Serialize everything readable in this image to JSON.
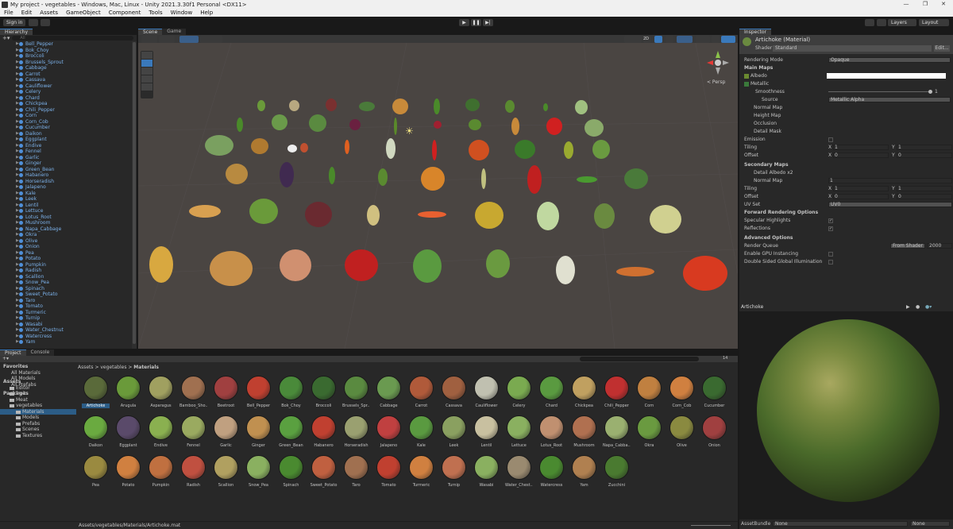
{
  "window": {
    "title": "My project - vegetables - Windows, Mac, Linux - Unity 2021.3.30f1 Personal <DX11>"
  },
  "menu": [
    "File",
    "Edit",
    "Assets",
    "GameObject",
    "Component",
    "Tools",
    "Window",
    "Help"
  ],
  "toolbar": {
    "signin": "Sign in",
    "layers": "Layers",
    "layout": "Layout"
  },
  "hierarchy": {
    "tab": "Hierarchy",
    "search_placeholder": "All",
    "items": [
      "Bell_Pepper",
      "Bok_Choy",
      "Broccoli",
      "Brussels_Sprout",
      "Cabbage",
      "Carrot",
      "Cassava",
      "Cauliflower",
      "Celery",
      "Chard",
      "Chickpea",
      "Chili_Pepper",
      "Corn",
      "Corn_Cob",
      "Cucumber",
      "Daikon",
      "Eggplant",
      "Endive",
      "Fennel",
      "Garlic",
      "Ginger",
      "Green_Bean",
      "Habanero",
      "Horseradish",
      "Jalapeno",
      "Kale",
      "Leek",
      "Lentil",
      "Lettuce",
      "Lotus_Root",
      "Mushroom",
      "Napa_Cabbage",
      "Okra",
      "Olive",
      "Onion",
      "Pea",
      "Potato",
      "Pumpkin",
      "Radish",
      "Scallion",
      "Snow_Pea",
      "Spinach",
      "Sweet_Potato",
      "Taro",
      "Tomato",
      "Turmeric",
      "Turnip",
      "Wasabi",
      "Water_Chestnut",
      "Watercress",
      "Yam"
    ]
  },
  "scene": {
    "tab_scene": "Scene",
    "tab_game": "Game",
    "persp": "< Persp",
    "mode_2d": "2D"
  },
  "inspector": {
    "tab": "Inspector",
    "title": "Artichoke (Material)",
    "shader_label": "Shader",
    "shader_value": "Standard",
    "edit": "Edit...",
    "rendering_mode_label": "Rendering Mode",
    "rendering_mode": "Opaque",
    "main_maps": "Main Maps",
    "albedo": "Albedo",
    "metallic": "Metallic",
    "smoothness": "Smoothness",
    "smoothness_value": "1",
    "source": "Source",
    "source_value": "Metallic Alpha",
    "normal_map": "Normal Map",
    "height_map": "Height Map",
    "occlusion": "Occlusion",
    "detail_mask": "Detail Mask",
    "emission": "Emission",
    "tiling": "Tiling",
    "offset": "Offset",
    "x": "X",
    "y": "Y",
    "one": "1",
    "zero": "0",
    "secondary_maps": "Secondary Maps",
    "detail_albedo": "Detail Albedo x2",
    "normal_map2": "Normal Map",
    "uv_set": "UV Set",
    "uv_value": "UV0",
    "forward_options": "Forward Rendering Options",
    "specular": "Specular Highlights",
    "reflections": "Reflections",
    "advanced": "Advanced Options",
    "render_queue": "Render Queue",
    "from_shader": "From Shader",
    "queue_value": "2000",
    "gpu_instancing": "Enable GPU Instancing",
    "double_sided": "Double Sided Global Illumination"
  },
  "preview": {
    "title": "Artichoke",
    "assetbundle": "AssetBundle",
    "none": "None",
    "none2": "None"
  },
  "project": {
    "tab_project": "Project",
    "tab_console": "Console",
    "count": "14",
    "favorites": "Favorites",
    "fav_items": [
      "All Materials",
      "All Models",
      "All Prefabs"
    ],
    "assets": "Assets",
    "tree": [
      "Editor",
      "fruits",
      "Meat",
      "vegetables",
      "Materials",
      "Models",
      "Prefabs",
      "Scenes",
      "Textures"
    ],
    "packages": "Packages",
    "breadcrumb": [
      "Assets",
      "vegetables",
      "Materials"
    ],
    "footer_path": "Assets/vegetables/Materials/Artichoke.mat",
    "materials": [
      "Artichoke",
      "Arugula",
      "Asparagus",
      "Bamboo_Sho...",
      "Beetroot",
      "Bell_Pepper",
      "Bok_Choy",
      "Broccoli",
      "Brussels_Spr...",
      "Cabbage",
      "Carrot",
      "Cassava",
      "Cauliflower",
      "Celery",
      "Chard",
      "Chickpea",
      "Chili_Pepper",
      "Corn",
      "Corn_Cob",
      "Cucumber",
      "Daikon",
      "Eggplant",
      "Endive",
      "Fennel",
      "Garlic",
      "Ginger",
      "Green_Bean",
      "Habanero",
      "Horseradish",
      "Jalapeno",
      "Kale",
      "Leek",
      "Lentil",
      "Lettuce",
      "Lotus_Root",
      "Mushroom",
      "Napa_Cabba...",
      "Okra",
      "Olive",
      "Onion",
      "Pea",
      "Potato",
      "Pumpkin",
      "Radish",
      "Scallion",
      "Snow_Pea",
      "Spinach",
      "Sweet_Potato",
      "Taro",
      "Tomato",
      "Turmeric",
      "Turnip",
      "Wasabi",
      "Water_Chest...",
      "Watercress",
      "Yam",
      "Zucchini"
    ]
  },
  "colors": {
    "accent": "#3a79bb",
    "hier_text": "#7bb0e8",
    "bg": "#282828"
  }
}
